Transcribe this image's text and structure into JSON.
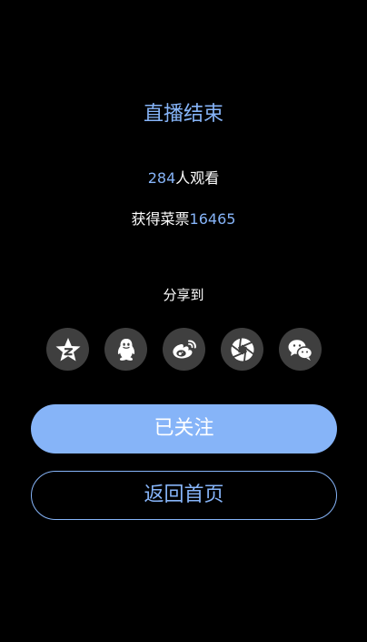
{
  "title": "直播结束",
  "viewers": {
    "count": "284",
    "label": "人观看"
  },
  "tickets": {
    "label": "获得菜票",
    "count": "16465"
  },
  "share": {
    "label": "分享到",
    "targets": [
      {
        "icon": "qzone-star-icon"
      },
      {
        "icon": "qq-penguin-icon"
      },
      {
        "icon": "weibo-icon"
      },
      {
        "icon": "moments-aperture-icon"
      },
      {
        "icon": "wechat-icon"
      }
    ]
  },
  "buttons": {
    "follow_label": "已关注",
    "home_label": "返回首页"
  },
  "colors": {
    "accent": "#86b4f8",
    "background": "#000000",
    "icon_circle": "#3f3f3f",
    "text": "#ffffff"
  }
}
